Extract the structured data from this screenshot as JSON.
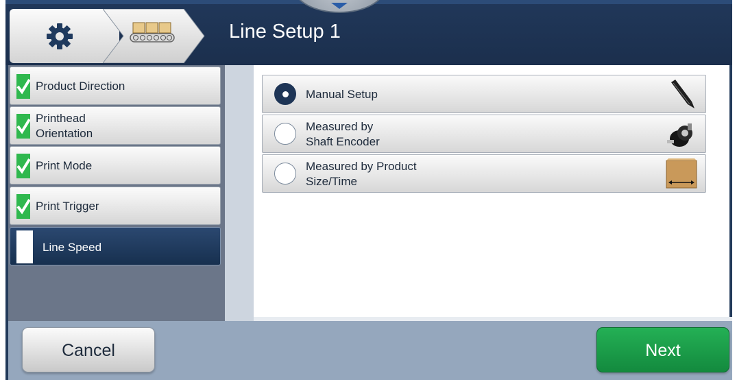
{
  "header": {
    "title": "Line Setup 1",
    "breadcrumb": [
      {
        "icon": "gear-icon"
      },
      {
        "icon": "conveyor-line-icon"
      }
    ]
  },
  "steps": [
    {
      "label": "Product Direction",
      "status": "completed"
    },
    {
      "label": "Printhead Orientation",
      "status": "completed"
    },
    {
      "label": "Print Mode",
      "status": "completed"
    },
    {
      "label": "Print Trigger",
      "status": "completed"
    },
    {
      "label": "Line Speed",
      "status": "current"
    }
  ],
  "options": [
    {
      "label": "Manual Setup",
      "selected": true,
      "icon": "pencil-icon"
    },
    {
      "label": "Measured by Shaft Encoder",
      "selected": false,
      "icon": "shaft-encoder-icon"
    },
    {
      "label": "Measured by Product Size/Time",
      "selected": false,
      "icon": "product-box-icon"
    }
  ],
  "footer": {
    "cancel_label": "Cancel",
    "next_label": "Next"
  },
  "colors": {
    "header_bg": "#1b2f4d",
    "next_green": "#1a9e4a",
    "check_green": "#2fb84e",
    "footer_bg": "#95a7bd"
  }
}
